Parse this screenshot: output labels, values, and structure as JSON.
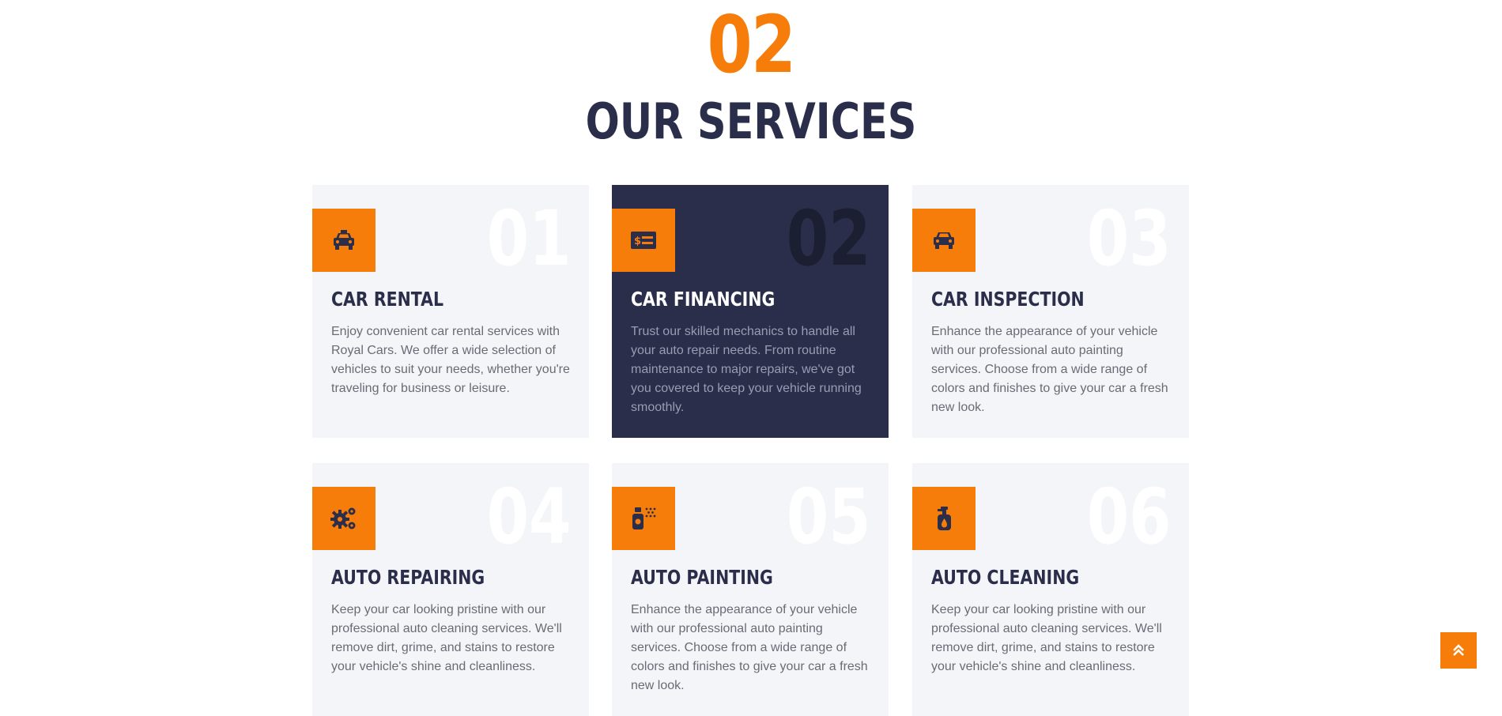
{
  "header": {
    "number": "02",
    "title": "OUR SERVICES"
  },
  "services": [
    {
      "number": "01",
      "title": "CAR RENTAL",
      "text": "Enjoy convenient car rental services with Royal Cars. We offer a wide selection of vehicles to suit your needs, whether you're traveling for business or leisure.",
      "icon": "taxi-icon",
      "active": false
    },
    {
      "number": "02",
      "title": "CAR FINANCING",
      "text": "Trust our skilled mechanics to handle all your auto repair needs. From routine maintenance to major repairs, we've got you covered to keep your vehicle running smoothly.",
      "icon": "money-check-icon",
      "active": true
    },
    {
      "number": "03",
      "title": "CAR INSPECTION",
      "text": "Enhance the appearance of your vehicle with our professional auto painting services. Choose from a wide range of colors and finishes to give your car a fresh new look.",
      "icon": "car-icon",
      "active": false
    },
    {
      "number": "04",
      "title": "AUTO REPAIRING",
      "text": "Keep your car looking pristine with our professional auto cleaning services. We'll remove dirt, grime, and stains to restore your vehicle's shine and cleanliness.",
      "icon": "cogs-icon",
      "active": false
    },
    {
      "number": "05",
      "title": "AUTO PAINTING",
      "text": "Enhance the appearance of your vehicle with our professional auto painting services. Choose from a wide range of colors and finishes to give your car a fresh new look.",
      "icon": "spray-can-icon",
      "active": false
    },
    {
      "number": "06",
      "title": "AUTO CLEANING",
      "text": "Keep your car looking pristine with our professional auto cleaning services. We'll remove dirt, grime, and stains to restore your vehicle's shine and cleanliness.",
      "icon": "pump-soap-icon",
      "active": false
    }
  ],
  "scroll_top": {
    "icon": "double-chevron-up-icon"
  },
  "colors": {
    "accent": "#F77D0A",
    "dark": "#2B2E4A",
    "card_bg": "#F4F5F8",
    "text": "#6B6A75"
  }
}
